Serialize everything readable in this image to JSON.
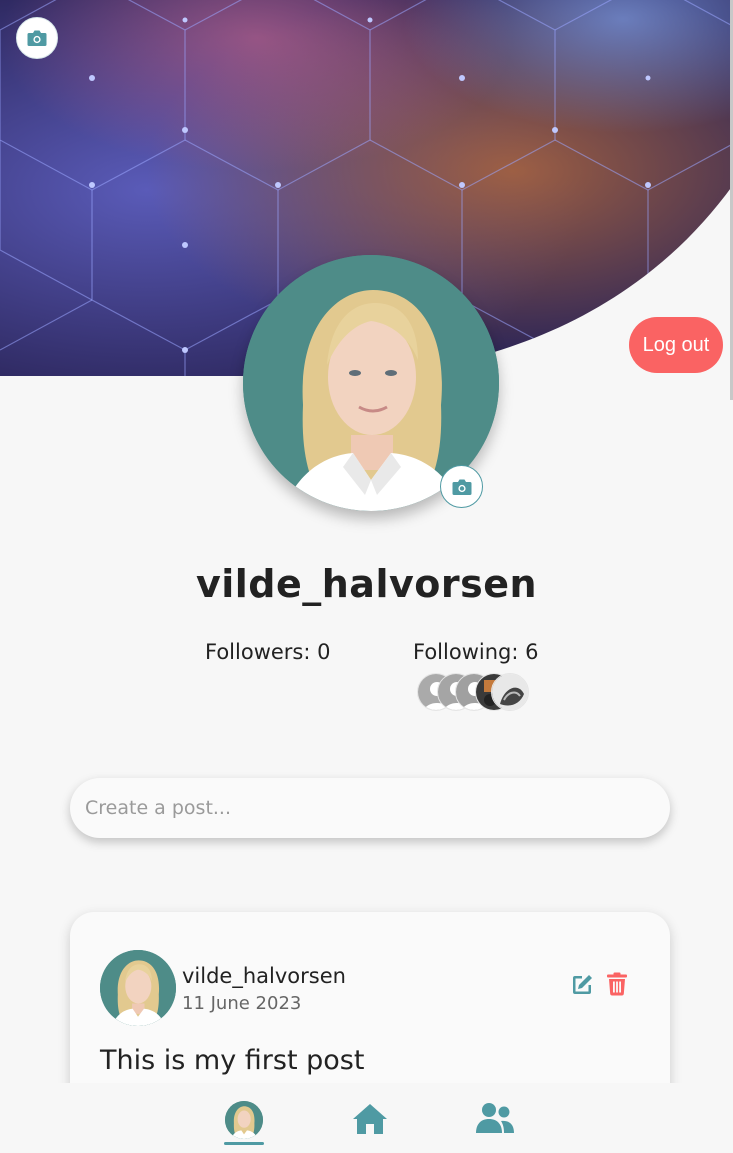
{
  "header": {
    "cover_camera_icon": "camera-icon",
    "logout_label": "Log out"
  },
  "profile": {
    "username": "vilde_halvorsen",
    "followers_text": "Followers: 0",
    "following_text": "Following: 6",
    "avatar_camera_icon": "camera-icon"
  },
  "composer": {
    "placeholder": "Create a post..."
  },
  "posts": [
    {
      "author": "vilde_halvorsen",
      "date": "11 June 2023",
      "text": "This is my first post",
      "edit_icon": "edit-icon",
      "delete_icon": "trash-icon"
    }
  ],
  "nav": {
    "items": [
      "profile",
      "home-icon",
      "friends-icon"
    ],
    "active": "profile"
  },
  "colors": {
    "accent": "#4f9aa3",
    "danger": "#fa6363",
    "avatar_bg": "#4e8c88",
    "background": "#f7f7f7"
  }
}
